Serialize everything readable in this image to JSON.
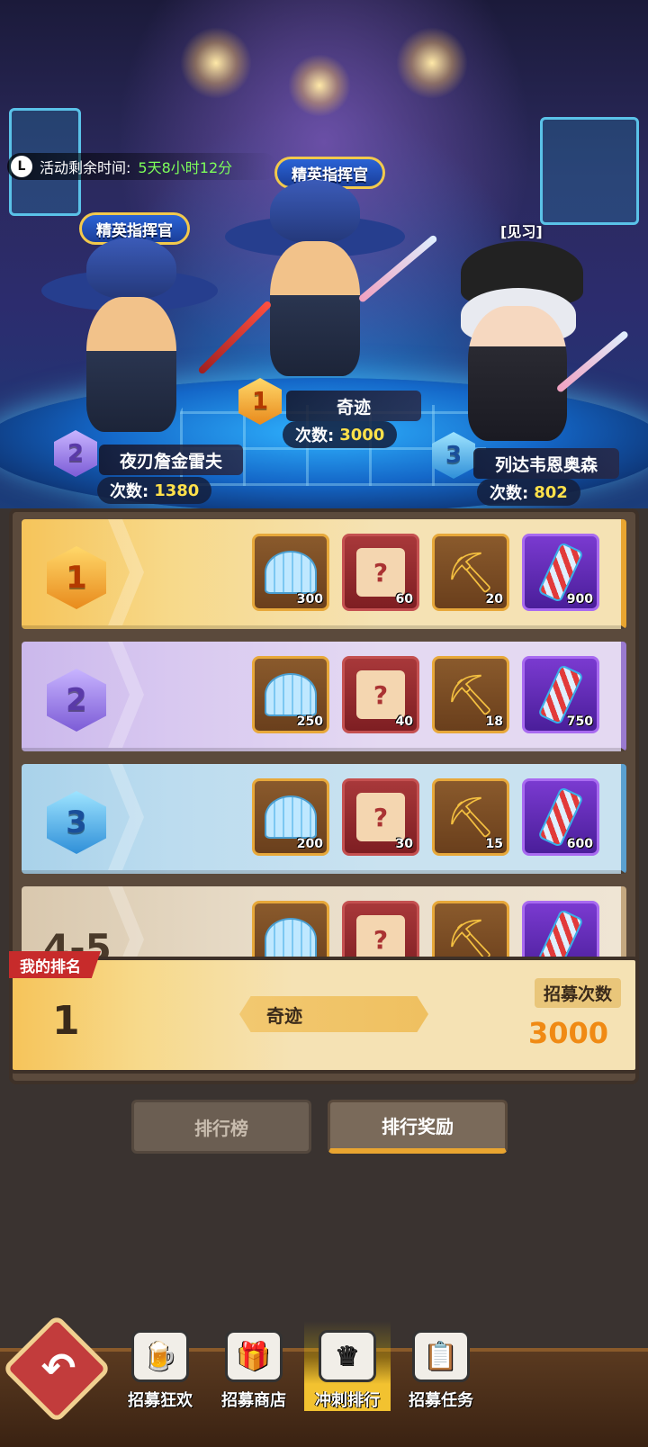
{
  "event": {
    "timer_label": "活动剩余时间:",
    "timer_value": "5天8小时12分"
  },
  "podium": {
    "title_badge": "精英指挥官",
    "trainee_tag": "[见习]",
    "count_label": "次数:",
    "first": {
      "rank": "1",
      "name": "奇迹",
      "count": "3000"
    },
    "second": {
      "rank": "2",
      "name": "夜刃詹金雷夫",
      "count": "1380"
    },
    "third": {
      "rank": "3",
      "name": "列达韦恩奥森",
      "count": "802"
    }
  },
  "rewards": [
    {
      "rank": "1",
      "items": [
        "300",
        "60",
        "20",
        "900"
      ]
    },
    {
      "rank": "2",
      "items": [
        "250",
        "40",
        "18",
        "750"
      ]
    },
    {
      "rank": "3",
      "items": [
        "200",
        "30",
        "15",
        "600"
      ]
    },
    {
      "rank": "4-5",
      "items": [
        "",
        "",
        "",
        ""
      ]
    }
  ],
  "reward_item_icons": [
    "shell-icon",
    "puzzle-icon",
    "pickaxe-icon",
    "test-tube-icon"
  ],
  "my_rank": {
    "tag": "我的排名",
    "rank": "1",
    "name": "奇迹",
    "count_label": "招募次数",
    "count_value": "3000"
  },
  "tabs": {
    "leaderboard": "排行榜",
    "rewards": "排行奖励",
    "active": "rewards"
  },
  "nav": {
    "carnival": "招募狂欢",
    "shop": "招募商店",
    "sprint": "冲刺排行",
    "tasks": "招募任务",
    "active": "sprint"
  },
  "colors": {
    "gold_row": "#f6c45a",
    "purple_row": "#cbb8ec",
    "blue_row": "#a9d2ea",
    "count_highlight": "#ffe14a",
    "my_count": "#f08a14",
    "timer_green": "#7dff5a"
  }
}
